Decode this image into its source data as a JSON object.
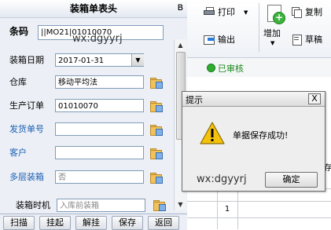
{
  "panel": {
    "title": "装箱单表头",
    "pin_glyph": "ʙ",
    "fields": {
      "barcode_label": "条码",
      "barcode_value": "||MO21|01010070",
      "date_label": "装箱日期",
      "date_value": "2017-01-31",
      "warehouse_label": "仓库",
      "warehouse_value": "移动平均法",
      "order_label": "生产订单",
      "order_value": "01010070",
      "shipno_label": "发货单号",
      "shipno_value": "",
      "customer_label": "客户",
      "customer_value": "",
      "multilayer_label": "多层装箱",
      "multilayer_value": "否",
      "timing_label": "装箱时机",
      "timing_value": "入库前装箱"
    },
    "watermark": "wx:dgyyrj"
  },
  "bottom_buttons": [
    "扫描",
    "挂起",
    "解挂",
    "保存",
    "返回"
  ],
  "toolbar": {
    "print": "打印",
    "copy": "复制",
    "export": "输出",
    "add": "增加",
    "draft": "草稿"
  },
  "status": {
    "text": "已审核"
  },
  "grid": {
    "rows": [
      "1"
    ],
    "side_char": "存"
  },
  "dialog": {
    "title": "提示",
    "close": "X",
    "message": "单据保存成功!",
    "ok": "确定",
    "watermark": "wx:dgyyrj"
  },
  "colors": {
    "accent_blue": "#1a5fb4",
    "status_green": "#2fae2f",
    "warning_yellow": "#f4c20d"
  }
}
